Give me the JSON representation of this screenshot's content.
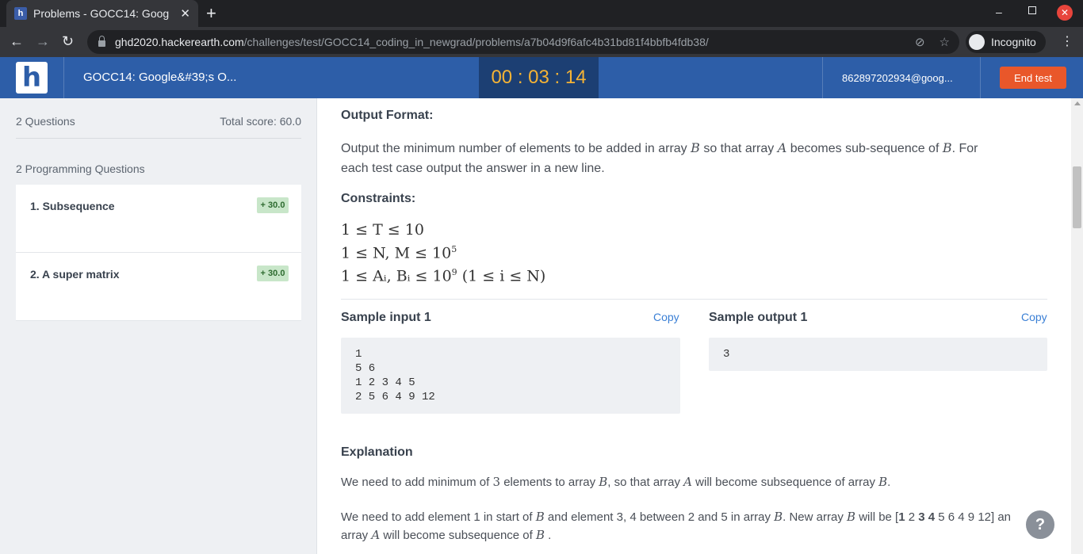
{
  "browser": {
    "tab_title": "Problems - GOCC14: Goog",
    "tab_favicon": "h",
    "url_host": "ghd2020.hackerearth.com",
    "url_path": "/challenges/test/GOCC14_coding_in_newgrad/problems/a7b04d9f6afc4b31bd81f4bbfb4fdb38/",
    "incognito_label": "Incognito"
  },
  "header": {
    "logo_text": "h",
    "contest_title": "GOCC14: Google&#39;s O...",
    "timer": "00 : 03 : 14",
    "user_email": "862897202934@goog...",
    "end_test_label": "End test"
  },
  "sidebar": {
    "question_count": "2 Questions",
    "total_score": "Total score: 60.0",
    "section_title": "2 Programming Questions",
    "questions": [
      {
        "label": "1. Subsequence",
        "score": "+ 30.0"
      },
      {
        "label": "2. A super matrix",
        "score": "+ 30.0"
      }
    ]
  },
  "problem": {
    "output_format_title": "Output Format:",
    "output_format_line1_a": "Output the minimum number of elements to be added in array ",
    "output_format_line1_b": "B",
    "output_format_line1_c": " so that array ",
    "output_format_line1_d": "A",
    "output_format_line1_e": " becomes sub-sequence of ",
    "output_format_line1_f": "B",
    "output_format_line1_g": ". For",
    "output_format_line2": "each test case output the answer in a new line.",
    "constraints_title": "Constraints:",
    "constraint1": "1 ≤ T ≤ 10",
    "constraint2_base": "1 ≤ N, M ≤ 10",
    "constraint2_exp": "5",
    "constraint3_base": "1 ≤ Aᵢ, Bᵢ ≤ 10",
    "constraint3_exp": "9",
    "constraint3_tail": " (1 ≤ i ≤ N)",
    "sample_input_title": "Sample input 1",
    "sample_output_title": "Sample output 1",
    "copy_label": "Copy",
    "sample_input": "1\n5 6\n1 2 3 4 5\n2 5 6 4 9 12",
    "sample_output": "3",
    "explanation_title": "Explanation",
    "explanation_p1_a": "We need to add minimum of ",
    "explanation_p1_b": "3",
    "explanation_p1_c": " elements to array ",
    "explanation_p1_d": "B",
    "explanation_p1_e": ", so that array ",
    "explanation_p1_f": "A",
    "explanation_p1_g": " will become subsequence of array ",
    "explanation_p1_h": "B",
    "explanation_p1_i": ".",
    "explanation_p2_a": "We need to add element 1 in start of ",
    "explanation_p2_b": "B",
    "explanation_p2_c": " and element 3, 4 between 2 and 5 in array ",
    "explanation_p2_d": "B",
    "explanation_p2_e": ". New array ",
    "explanation_p2_f": "B",
    "explanation_p2_g": " will be [",
    "explanation_p2_h": "1",
    "explanation_p2_i": " 2 ",
    "explanation_p2_j": "3 4",
    "explanation_p2_k": " 5 6 4 9 12] an",
    "explanation_p3_a": "array ",
    "explanation_p3_b": "A",
    "explanation_p3_c": " will become subsequence of ",
    "explanation_p3_d": "B",
    "explanation_p3_e": " ."
  },
  "help_label": "?"
}
